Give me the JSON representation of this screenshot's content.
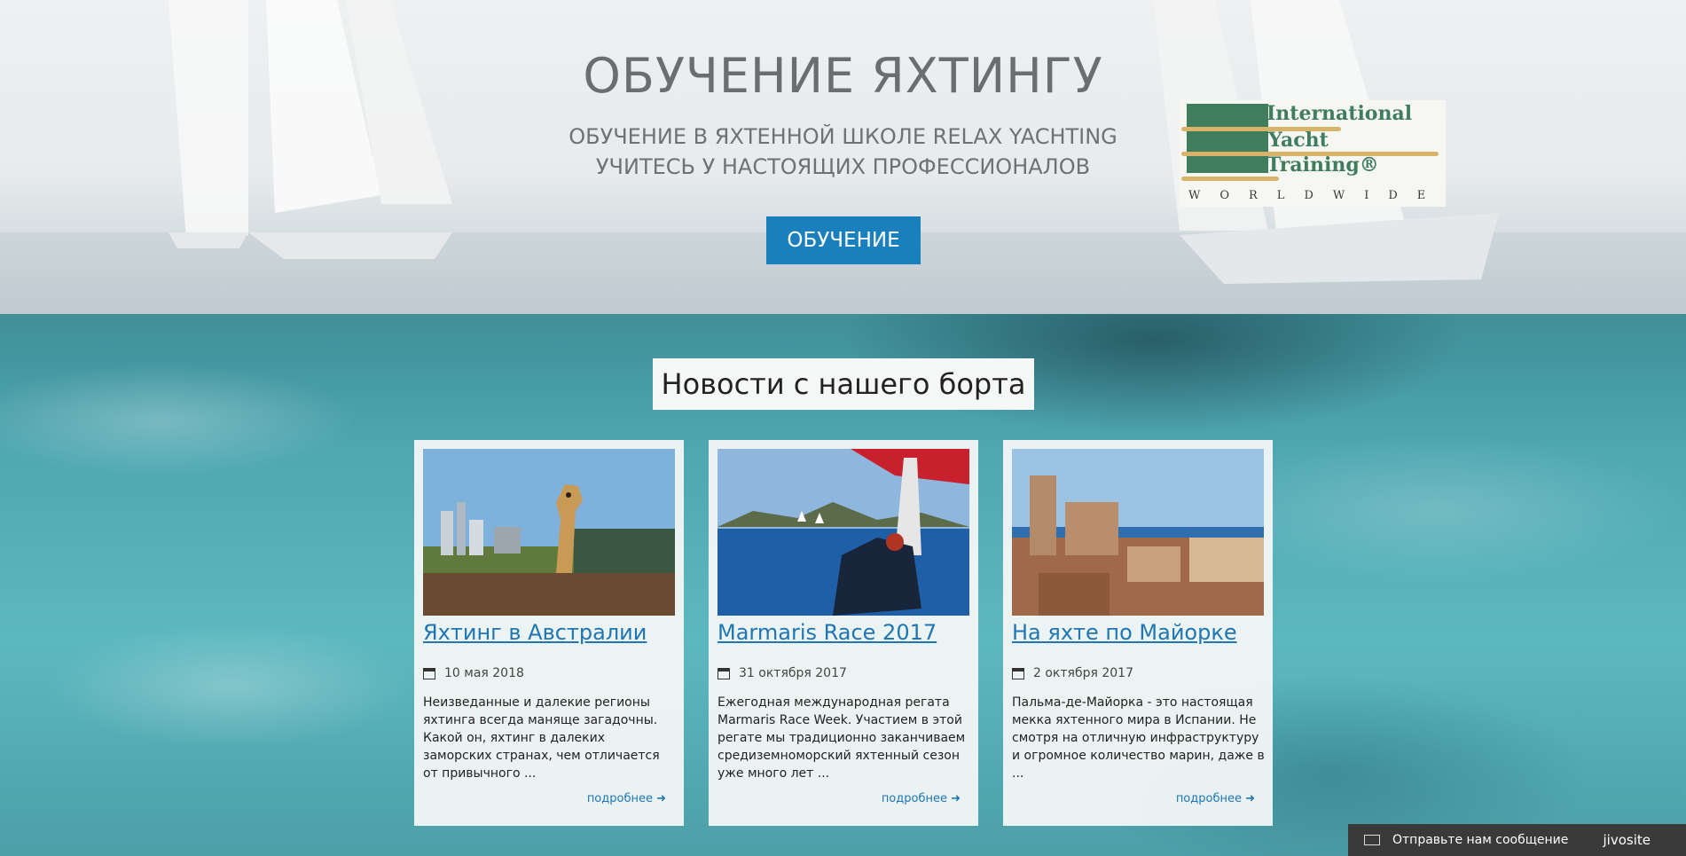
{
  "hero": {
    "title": "ОБУЧЕНИЕ ЯХТИНГУ",
    "subtitle_line1": "ОБУЧЕНИЕ В ЯХТЕННОЙ ШКОЛЕ RELAX YACHTING",
    "subtitle_line2": "УЧИТЕСЬ У НАСТОЯЩИХ ПРОФЕССИОНАЛОВ",
    "button_label": "ОБУЧЕНИЕ",
    "button_color": "#1a7fbd"
  },
  "logo": {
    "line1": "International",
    "line2": "Yacht",
    "line3": "Training®",
    "tagline": "WORLDWIDE",
    "color": "#3f7d5c"
  },
  "news": {
    "section_title": "Новости с нашего борта",
    "cards": [
      {
        "title": "Яхтинг в Австралии",
        "date": "10 мая 2018",
        "excerpt": "Неизведанные и далекие регионы яхтинга всегда маняще загадочны. Какой он, яхтинг в далеких заморских странах, чем отличается от привычного ...",
        "more_label": "подробнее ➜",
        "image": "giraffe-sydney-photo"
      },
      {
        "title": "Marmaris Race 2017",
        "date": "31 октября 2017",
        "excerpt": "Ежегодная международная регата Marmaris Race Week. Участием в этой регате мы традиционно заканчиваем средиземноморский яхтенный сезон уже много лет ...",
        "more_label": "подробнее ➜",
        "image": "sailing-regatta-photo"
      },
      {
        "title": "На яхте по Майорке",
        "date": "2 октября 2017",
        "excerpt": "Пальма-де-Майорка - это настоящая мекка яхтенного мира в Испании. Не смотря на отличную инфраструктуру и огромное количество марин, даже в ...",
        "more_label": "подробнее ➜",
        "image": "mallorca-town-photo"
      }
    ]
  },
  "chat": {
    "label": "Отправьте нам сообщение",
    "brand": "jivosite"
  },
  "colors": {
    "link": "#1f76b3",
    "water": "#4fa7b1"
  }
}
